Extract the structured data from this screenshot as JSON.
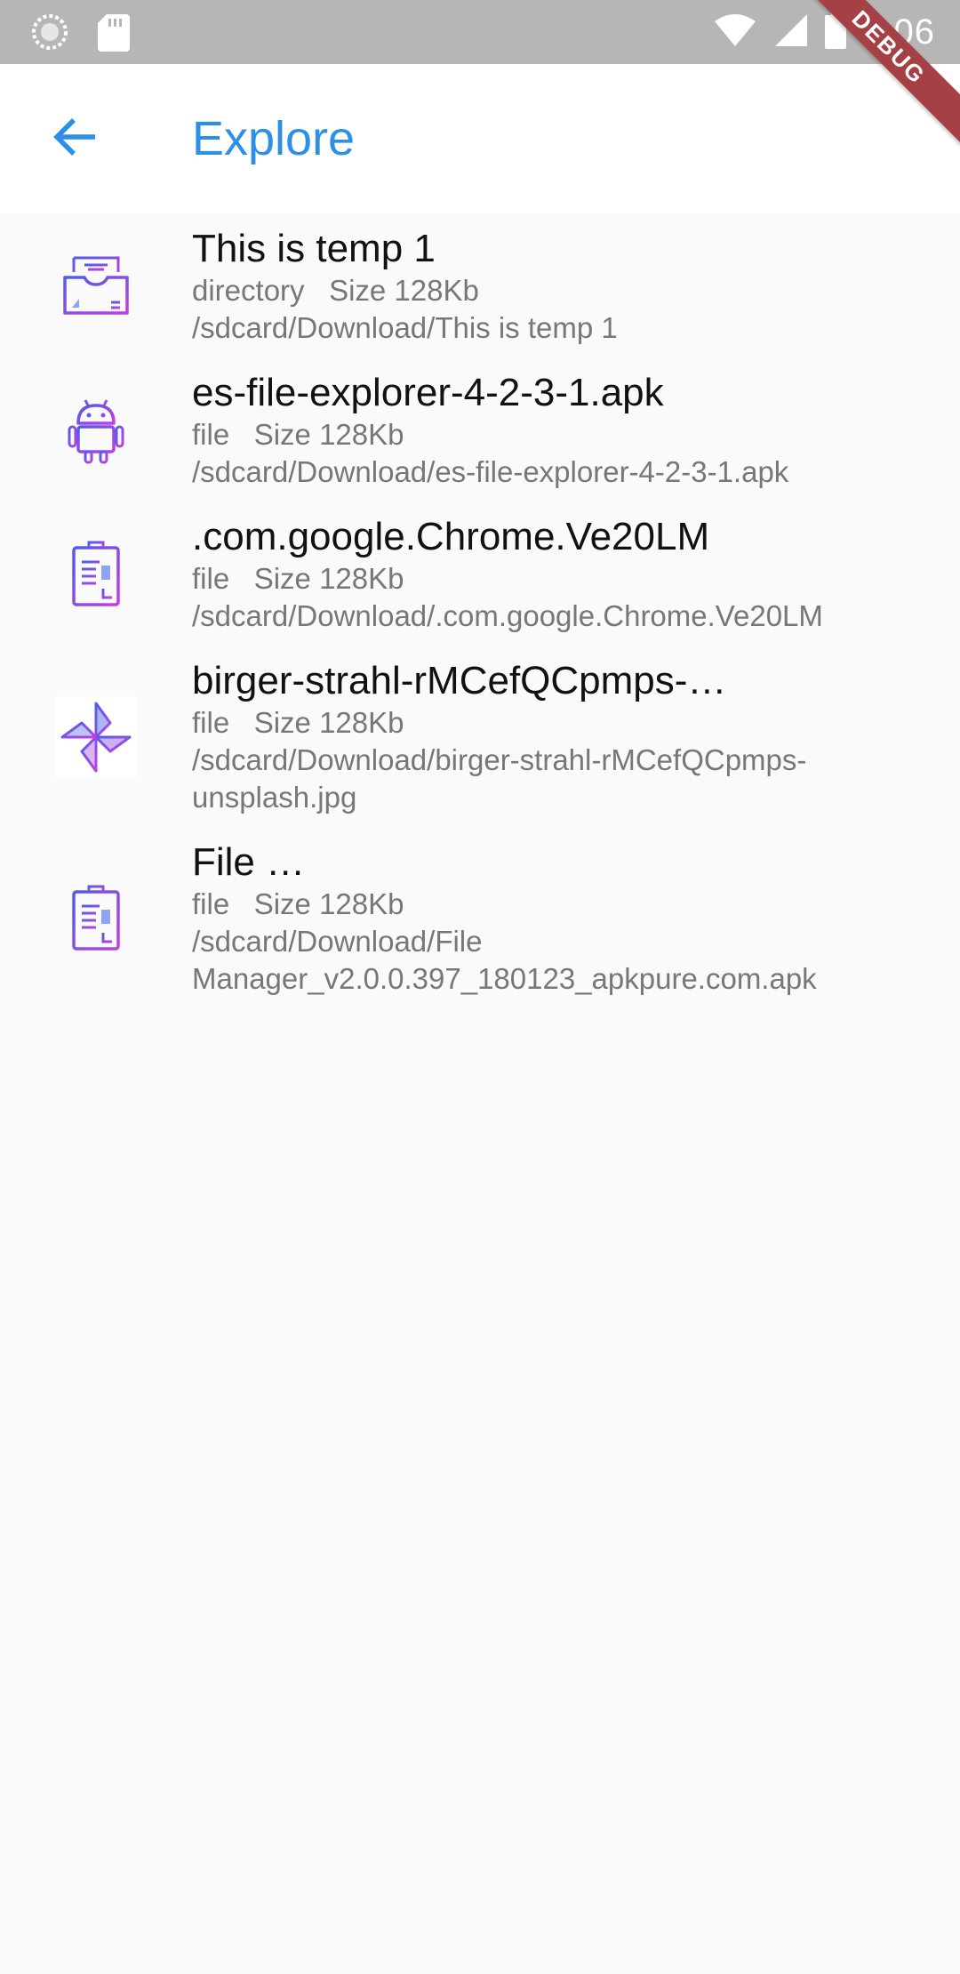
{
  "status_bar": {
    "time": "1:06",
    "debug_label": "DEBUG"
  },
  "app_bar": {
    "title": "Explore",
    "back_icon": "arrow-back-icon",
    "title_color": "#2d8fe6"
  },
  "files": [
    {
      "name": "This is temp 1",
      "type": "directory",
      "size": "Size 128Kb",
      "path": "/sdcard/Download/This is temp 1",
      "icon": "folder-inbox-icon"
    },
    {
      "name": "es-file-explorer-4-2-3-1.apk",
      "type": "file",
      "size": "Size 128Kb",
      "path": "/sdcard/Download/es-file-explorer-4-2-3-1.apk",
      "icon": "android-icon"
    },
    {
      "name": ".com.google.Chrome.Ve20LM",
      "type": "file",
      "size": "Size 128Kb",
      "path": "/sdcard/Download/.com.google.Chrome.Ve20LM",
      "icon": "document-icon"
    },
    {
      "name": "birger-strahl-rMCefQCpmps-…",
      "type": "file",
      "size": "Size 128Kb",
      "path": "/sdcard/Download/birger-strahl-rMCefQCpmps-unsplash.jpg",
      "icon": "pinwheel-image-icon"
    },
    {
      "name": "File …",
      "type": "file",
      "size": "Size 128Kb",
      "path": "/sdcard/Download/File Manager_v2.0.0.397_180123_apkpure.com.apk",
      "icon": "document-icon"
    }
  ]
}
